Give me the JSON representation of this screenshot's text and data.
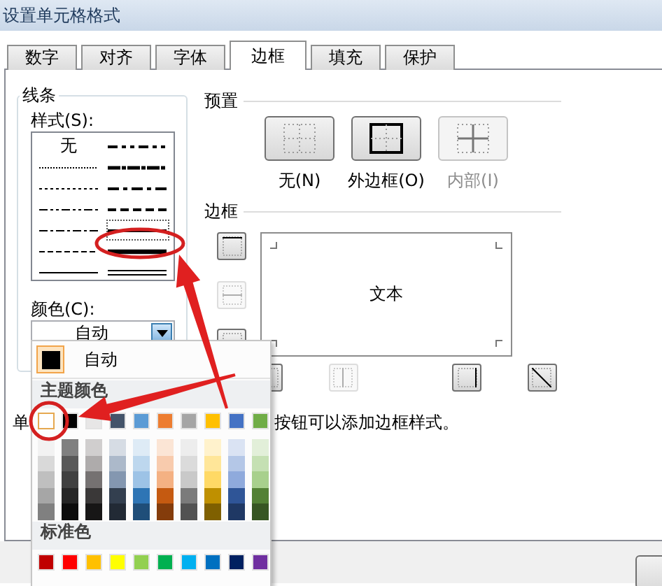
{
  "window": {
    "title": "设置单元格格式"
  },
  "tabs": [
    {
      "label": "数字",
      "selected": false
    },
    {
      "label": "对齐",
      "selected": false
    },
    {
      "label": "字体",
      "selected": false
    },
    {
      "label": "边框",
      "selected": true
    },
    {
      "label": "填充",
      "selected": false
    },
    {
      "label": "保护",
      "selected": false
    }
  ],
  "line": {
    "title": "线条",
    "style_label": "样式(S):",
    "styles": [
      {
        "kind": "none",
        "label": "无",
        "selected": false
      },
      {
        "kind": "medium-dashdotdot",
        "selected": false
      },
      {
        "kind": "hair",
        "selected": false
      },
      {
        "kind": "slant-dashdot",
        "selected": false
      },
      {
        "kind": "dotted",
        "selected": false
      },
      {
        "kind": "medium-dashdot",
        "selected": false
      },
      {
        "kind": "dashdotdot",
        "selected": false
      },
      {
        "kind": "medium-dashed",
        "selected": false
      },
      {
        "kind": "dashdot",
        "selected": false
      },
      {
        "kind": "medium",
        "selected": true
      },
      {
        "kind": "dashed",
        "selected": false
      },
      {
        "kind": "thick",
        "selected": false
      },
      {
        "kind": "thin",
        "selected": false
      },
      {
        "kind": "double",
        "selected": false
      }
    ],
    "color_label": "颜色(C):",
    "color_value": "自动"
  },
  "presets": {
    "title": "预置",
    "items": [
      {
        "kind": "none",
        "label": "无(N)",
        "disabled": false
      },
      {
        "kind": "outline",
        "label": "外边框(O)",
        "disabled": false
      },
      {
        "kind": "inside",
        "label": "内部(I)",
        "disabled": true
      }
    ]
  },
  "border": {
    "title": "边框",
    "preview_text": "文本",
    "side_buttons": [
      {
        "kind": "top",
        "disabled": false
      },
      {
        "kind": "middle",
        "disabled": true
      },
      {
        "kind": "bottom",
        "disabled": false
      }
    ],
    "bottom_buttons": [
      {
        "kind": "left",
        "disabled": false
      },
      {
        "kind": "center",
        "disabled": true
      },
      {
        "kind": "right",
        "disabled": false
      },
      {
        "kind": "diagonal",
        "disabled": false
      }
    ]
  },
  "hint": [
    "单",
    "按钮可以添加边框样式。"
  ],
  "color_menu": {
    "auto": {
      "label": "自动",
      "selected": true
    },
    "theme_title": "主题颜色",
    "theme": [
      {
        "color": "#ffffff",
        "selected": true,
        "shades": [
          {
            "color": "#f2f2f2"
          },
          {
            "color": "#d9d9d9"
          },
          {
            "color": "#bfbfbf"
          },
          {
            "color": "#a6a6a6"
          },
          {
            "color": "#808080"
          }
        ]
      },
      {
        "color": "#000000",
        "selected": false,
        "shades": [
          {
            "color": "#808080"
          },
          {
            "color": "#595959"
          },
          {
            "color": "#404040"
          },
          {
            "color": "#262626"
          },
          {
            "color": "#0d0d0d"
          }
        ]
      },
      {
        "color": "#e7e6e6",
        "selected": false,
        "shades": [
          {
            "color": "#d0cece"
          },
          {
            "color": "#aeabab"
          },
          {
            "color": "#757171"
          },
          {
            "color": "#3a3838"
          },
          {
            "color": "#171616"
          }
        ]
      },
      {
        "color": "#44546a",
        "selected": false,
        "shades": [
          {
            "color": "#d6dce4"
          },
          {
            "color": "#acb9ca"
          },
          {
            "color": "#8497b0"
          },
          {
            "color": "#333f4f"
          },
          {
            "color": "#222a35"
          }
        ]
      },
      {
        "color": "#5b9bd5",
        "selected": false,
        "shades": [
          {
            "color": "#deebf6"
          },
          {
            "color": "#bdd7ee"
          },
          {
            "color": "#9dc3e6"
          },
          {
            "color": "#2e75b5"
          },
          {
            "color": "#1f4e79"
          }
        ]
      },
      {
        "color": "#ed7d31",
        "selected": false,
        "shades": [
          {
            "color": "#fbe5d5"
          },
          {
            "color": "#f8cbad"
          },
          {
            "color": "#f4b183"
          },
          {
            "color": "#c55a11"
          },
          {
            "color": "#843c0b"
          }
        ]
      },
      {
        "color": "#a5a5a5",
        "selected": false,
        "shades": [
          {
            "color": "#ededed"
          },
          {
            "color": "#dbdbdb"
          },
          {
            "color": "#c9c9c9"
          },
          {
            "color": "#7b7b7b"
          },
          {
            "color": "#525252"
          }
        ]
      },
      {
        "color": "#ffc000",
        "selected": false,
        "shades": [
          {
            "color": "#fff2cc"
          },
          {
            "color": "#ffe699"
          },
          {
            "color": "#ffd965"
          },
          {
            "color": "#bf9000"
          },
          {
            "color": "#7f6000"
          }
        ]
      },
      {
        "color": "#4472c4",
        "selected": false,
        "shades": [
          {
            "color": "#dae3f3"
          },
          {
            "color": "#b4c7e7"
          },
          {
            "color": "#8faadc"
          },
          {
            "color": "#2f5597"
          },
          {
            "color": "#1f3864"
          }
        ]
      },
      {
        "color": "#70ad47",
        "selected": false,
        "shades": [
          {
            "color": "#e2efd9"
          },
          {
            "color": "#c5e0b3"
          },
          {
            "color": "#a8d08d"
          },
          {
            "color": "#538135"
          },
          {
            "color": "#375623"
          }
        ]
      }
    ],
    "standard_title": "标准色",
    "standard": [
      {
        "color": "#c00000"
      },
      {
        "color": "#ff0000"
      },
      {
        "color": "#ffc000"
      },
      {
        "color": "#ffff00"
      },
      {
        "color": "#92d050"
      },
      {
        "color": "#00b050"
      },
      {
        "color": "#00b0f0"
      },
      {
        "color": "#0070c0"
      },
      {
        "color": "#002060"
      },
      {
        "color": "#7030a0"
      }
    ]
  }
}
